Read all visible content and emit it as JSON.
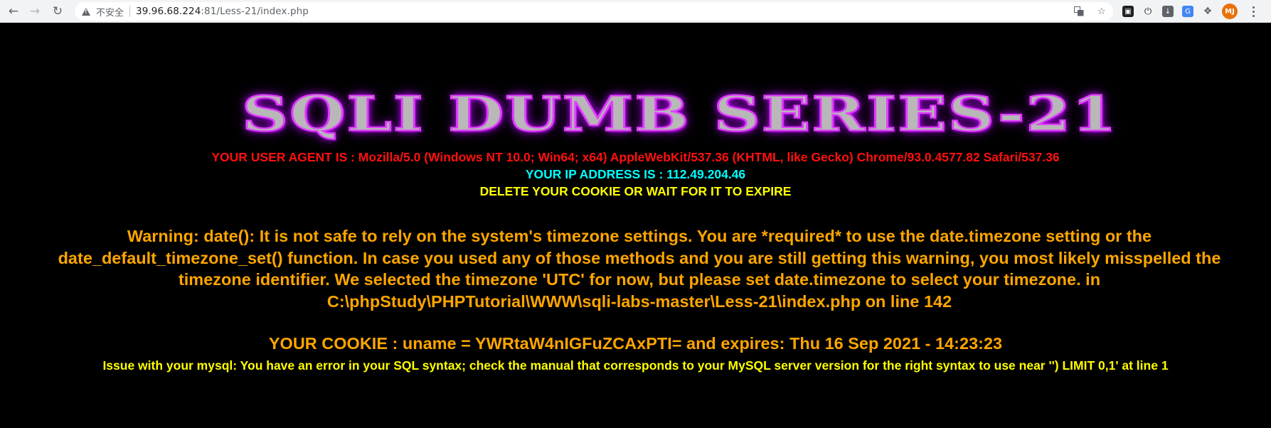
{
  "browser": {
    "security_label": "不安全",
    "url_host": "39.96.68.224",
    "url_rest": ":81/Less-21/index.php",
    "icons": [
      "back-icon",
      "forward-icon",
      "reload-icon",
      "not-secure-icon",
      "translate-icon",
      "bookmark-star-icon",
      "extension-icons",
      "puzzle-icon",
      "profile-avatar",
      "menu-icon"
    ],
    "avatar_initials": "MJ",
    "accent": "#e8710a"
  },
  "page": {
    "banner_text": "SQLI DUMB SERIES-21",
    "user_agent": "YOUR USER AGENT IS : Mozilla/5.0 (Windows NT 10.0; Win64; x64) AppleWebKit/537.36 (KHTML, like Gecko) Chrome/93.0.4577.82 Safari/537.36",
    "ip_address": "YOUR IP ADDRESS IS : 112.49.204.46",
    "delete_cookie": "DELETE YOUR COOKIE OR WAIT FOR IT TO EXPIRE",
    "warning_lines": [
      "Warning: date(): It is not safe to rely on the system's timezone settings. You are *required* to use the date.timezone setting or the",
      "date_default_timezone_set() function. In case you used any of those methods and you are still getting this warning, you most likely misspelled the",
      "timezone identifier. We selected the timezone 'UTC' for now, but please set date.timezone to select your timezone. in",
      "C:\\phpStudy\\PHPTutorial\\WWW\\sqli-labs-master\\Less-21\\index.php on line 142"
    ],
    "cookie_info": "YOUR COOKIE : uname = YWRtaW4nIGFuZCAxPTI= and expires: Thu 16 Sep 2021 - 14:23:23",
    "mysql_error": "Issue with your mysql: You have an error in your SQL syntax; check the manual that corresponds to your MySQL server version for the right syntax to use near '') LIMIT 0,1' at line 1",
    "colors": {
      "background": "#000000",
      "user_agent": "#ff1010",
      "ip_address": "#00ffff",
      "delete_cookie": "#ffff00",
      "warning": "#ffa500",
      "mysql_error": "#ffff00",
      "banner_glow": "#e040fb"
    }
  }
}
